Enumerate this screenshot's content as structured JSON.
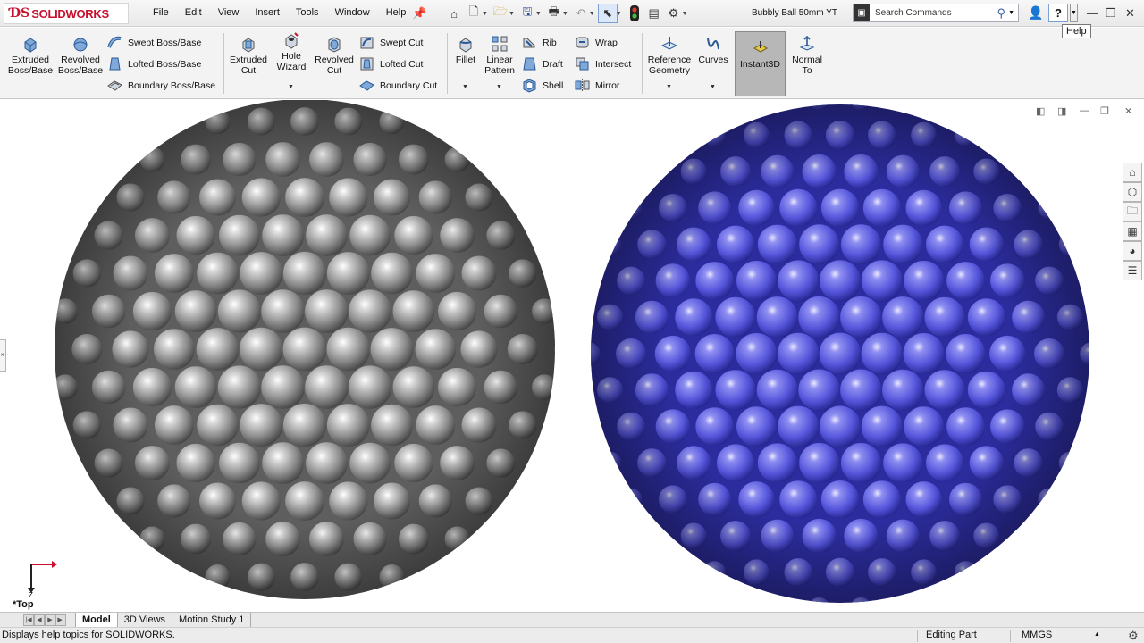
{
  "app": {
    "logo_text": "SOLIDWORKS",
    "menu": [
      "File",
      "Edit",
      "View",
      "Insert",
      "Tools",
      "Window",
      "Help"
    ],
    "document_title": "Bubbly Ball 50mm YT",
    "search_placeholder": "Search Commands",
    "help_tooltip": "Help",
    "help_label": "?"
  },
  "ribbon": {
    "features": {
      "extruded_boss": "Extruded\nBoss/Base",
      "revolved_boss": "Revolved\nBoss/Base",
      "swept_boss": "Swept Boss/Base",
      "lofted_boss": "Lofted Boss/Base",
      "boundary_boss": "Boundary Boss/Base",
      "extruded_cut": "Extruded\nCut",
      "hole_wizard": "Hole\nWizard",
      "revolved_cut": "Revolved\nCut",
      "swept_cut": "Swept Cut",
      "lofted_cut": "Lofted Cut",
      "boundary_cut": "Boundary Cut",
      "fillet": "Fillet",
      "linear_pattern": "Linear\nPattern",
      "rib": "Rib",
      "draft": "Draft",
      "shell": "Shell",
      "wrap": "Wrap",
      "intersect": "Intersect",
      "mirror": "Mirror",
      "reference_geometry": "Reference\nGeometry",
      "curves": "Curves",
      "instant3d": "Instant3D",
      "normal_to": "Normal\nTo"
    }
  },
  "viewport": {
    "view_name": "*Top",
    "triad_axis": "Z",
    "models": [
      {
        "name": "bubbly-ball-gray",
        "color": "#9a9a9a"
      },
      {
        "name": "bubbly-ball-blue",
        "color": "#5858e0"
      }
    ]
  },
  "tabs": [
    "Model",
    "3D Views",
    "Motion Study 1"
  ],
  "status": {
    "message": "Displays help topics for SOLIDWORKS.",
    "mode": "Editing Part",
    "units": "MMGS"
  }
}
